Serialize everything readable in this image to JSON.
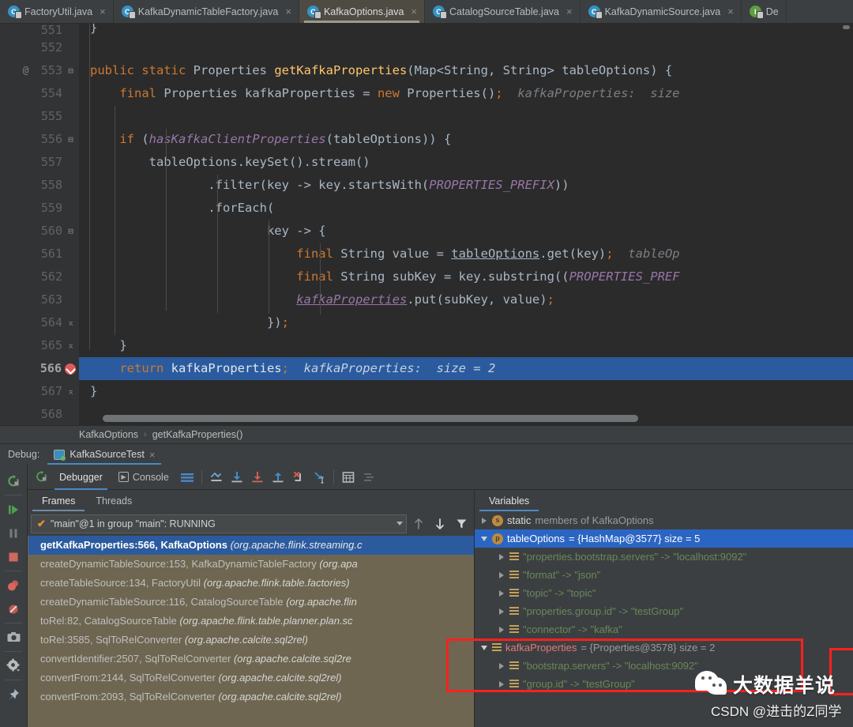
{
  "editor_tabs": [
    {
      "label": "FactoryUtil.java",
      "icon": "java-class-icon",
      "active": false
    },
    {
      "label": "KafkaDynamicTableFactory.java",
      "icon": "java-class-icon",
      "active": false
    },
    {
      "label": "KafkaOptions.java",
      "icon": "java-class-icon",
      "active": true
    },
    {
      "label": "CatalogSourceTable.java",
      "icon": "java-class-icon",
      "active": false
    },
    {
      "label": "KafkaDynamicSource.java",
      "icon": "java-class-icon",
      "active": false
    },
    {
      "label": "De",
      "icon": "java-interface-icon",
      "active": false
    }
  ],
  "tab_close_glyph": "×",
  "editor": {
    "lines": [
      {
        "num": "551",
        "annot": "",
        "fold": "",
        "partial": true
      },
      {
        "num": "552",
        "annot": "",
        "fold": ""
      },
      {
        "num": "553",
        "annot": "@",
        "fold": "minus"
      },
      {
        "num": "554",
        "annot": "",
        "fold": ""
      },
      {
        "num": "555",
        "annot": "",
        "fold": ""
      },
      {
        "num": "556",
        "annot": "",
        "fold": "minus"
      },
      {
        "num": "557",
        "annot": "",
        "fold": ""
      },
      {
        "num": "558",
        "annot": "",
        "fold": ""
      },
      {
        "num": "559",
        "annot": "",
        "fold": ""
      },
      {
        "num": "560",
        "annot": "",
        "fold": "minus"
      },
      {
        "num": "561",
        "annot": "",
        "fold": ""
      },
      {
        "num": "562",
        "annot": "",
        "fold": ""
      },
      {
        "num": "563",
        "annot": "",
        "fold": ""
      },
      {
        "num": "564",
        "annot": "",
        "fold": "up"
      },
      {
        "num": "565",
        "annot": "",
        "fold": "up"
      },
      {
        "num": "566",
        "annot": "breakpoint",
        "fold": "",
        "current": true
      },
      {
        "num": "567",
        "annot": "",
        "fold": "up"
      },
      {
        "num": "568",
        "annot": "",
        "fold": ""
      }
    ],
    "code": {
      "l551": "}",
      "l553": "public static Properties getKafkaProperties(Map<String, String> tableOptions) {",
      "l554": "final Properties kafkaProperties = new Properties();",
      "l554_hint": "kafkaProperties:  size",
      "l556": "if (hasKafkaClientProperties(tableOptions)) {",
      "l557": "tableOptions.keySet().stream()",
      "l558": ".filter(key -> key.startsWith(PROPERTIES_PREFIX))",
      "l559": ".forEach(",
      "l560": "key -> {",
      "l561": "final String value = tableOptions.get(key);",
      "l561_hint": "tableOp",
      "l562": "final String subKey = key.substring((PROPERTIES_PREF",
      "l563": "kafkaProperties.put(subKey, value);",
      "l564": "});",
      "l565": "}",
      "l566": "return kafkaProperties;",
      "l566_hint": "kafkaProperties:  size = 2",
      "l567": "}"
    }
  },
  "breadcrumb": {
    "class": "KafkaOptions",
    "separator": "›",
    "method": "getKafkaProperties()"
  },
  "debug_bar": {
    "label": "Debug:",
    "session": "KafkaSourceTest",
    "close_glyph": "×"
  },
  "left_rail": [
    {
      "name": "rerun-icon",
      "title": "Rerun"
    },
    {
      "name": "resume-program-icon",
      "title": "Resume Program"
    },
    {
      "name": "pause-program-icon",
      "title": "Pause Program"
    },
    {
      "name": "stop-icon",
      "title": "Stop"
    },
    {
      "name": "view-breakpoints-icon",
      "title": "View Breakpoints"
    },
    {
      "name": "mute-breakpoints-icon",
      "title": "Mute Breakpoints"
    },
    {
      "name": "camera-icon",
      "title": "Get thread dump"
    },
    {
      "name": "settings-gear-icon",
      "title": "Settings"
    },
    {
      "name": "pin-icon",
      "title": "Pin Tab"
    }
  ],
  "toolbar": {
    "restart_icon": "restart-icon",
    "tabs": [
      {
        "label": "Debugger",
        "active": true,
        "icon": ""
      },
      {
        "label": "Console",
        "active": false,
        "icon": "console-icon"
      }
    ],
    "layout_icon": "layout-settings-icon",
    "buttons": [
      {
        "name": "show-execution-point-icon"
      },
      {
        "name": "step-over-icon"
      },
      {
        "name": "step-into-icon"
      },
      {
        "name": "step-out-icon"
      },
      {
        "name": "force-step-into-icon"
      },
      {
        "name": "run-to-cursor-icon"
      },
      {
        "name": "evaluate-expression-icon"
      },
      {
        "name": "mute-renderers-icon"
      }
    ]
  },
  "frames_pane": {
    "tabs": [
      {
        "label": "Frames",
        "active": true
      },
      {
        "label": "Threads",
        "active": false
      }
    ],
    "thread_selector": {
      "value": "\"main\"@1 in group \"main\": RUNNING",
      "check_glyph": "✔"
    },
    "thread_buttons": [
      {
        "name": "frames-up-icon"
      },
      {
        "name": "frames-down-icon"
      },
      {
        "name": "filter-frames-icon"
      }
    ],
    "frames": [
      {
        "method": "getKafkaProperties:566, KafkaOptions ",
        "pkg": "(org.apache.flink.streaming.c",
        "selected": true
      },
      {
        "method": "createDynamicTableSource:153, KafkaDynamicTableFactory ",
        "pkg": "(org.apa",
        "selected": false
      },
      {
        "method": "createTableSource:134, FactoryUtil ",
        "pkg": "(org.apache.flink.table.factories)",
        "selected": false
      },
      {
        "method": "createDynamicTableSource:116, CatalogSourceTable ",
        "pkg": "(org.apache.flin",
        "selected": false
      },
      {
        "method": "toRel:82, CatalogSourceTable ",
        "pkg": "(org.apache.flink.table.planner.plan.sc",
        "selected": false
      },
      {
        "method": "toRel:3585, SqlToRelConverter ",
        "pkg": "(org.apache.calcite.sql2rel)",
        "selected": false
      },
      {
        "method": "convertIdentifier:2507, SqlToRelConverter ",
        "pkg": "(org.apache.calcite.sql2re",
        "selected": false
      },
      {
        "method": "convertFrom:2144, SqlToRelConverter ",
        "pkg": "(org.apache.calcite.sql2rel)",
        "selected": false
      },
      {
        "method": "convertFrom:2093, SqlToRelConverter ",
        "pkg": "(org.apache.calcite.sql2rel)",
        "selected": false
      }
    ]
  },
  "variables_pane": {
    "tabs": [
      {
        "label": "Variables",
        "active": true
      }
    ],
    "rows": [
      {
        "indent": 0,
        "arrow": "right",
        "icon": "static-icon",
        "icon_label": "s",
        "name": "static",
        "name_class": "strong",
        "suffix": " members of KafkaOptions",
        "selected": false
      },
      {
        "indent": 0,
        "arrow": "down",
        "icon": "param-icon",
        "icon_label": "p",
        "name": "tableOptions",
        "name_class": "strong",
        "suffix": " = {HashMap@3577}  size = 5",
        "selected": true
      },
      {
        "indent": 1,
        "arrow": "right",
        "icon": "map-entry-icon",
        "entry": "\"properties.bootstrap.servers\" -> \"localhost:9092\"",
        "selected": false
      },
      {
        "indent": 1,
        "arrow": "right",
        "icon": "map-entry-icon",
        "entry": "\"format\" -> \"json\"",
        "selected": false
      },
      {
        "indent": 1,
        "arrow": "right",
        "icon": "map-entry-icon",
        "entry": "\"topic\" -> \"topic\"",
        "selected": false
      },
      {
        "indent": 1,
        "arrow": "right",
        "icon": "map-entry-icon",
        "entry": "\"properties.group.id\" -> \"testGroup\"",
        "selected": false
      },
      {
        "indent": 1,
        "arrow": "right",
        "icon": "map-entry-icon",
        "entry": "\"connector\" -> \"kafka\"",
        "selected": false
      },
      {
        "indent": 0,
        "arrow": "down",
        "icon": "map-entry-icon",
        "name": "kafkaProperties",
        "name_class": "red",
        "suffix": " = {Properties@3578}  size = 2",
        "selected": false
      },
      {
        "indent": 1,
        "arrow": "right",
        "icon": "map-entry-icon",
        "entry": "\"bootstrap.servers\" -> \"localhost:9092\"",
        "selected": false
      },
      {
        "indent": 1,
        "arrow": "right",
        "icon": "map-entry-icon",
        "entry": "\"group.id\" -> \"testGroup\"",
        "selected": false
      }
    ]
  },
  "watermark": {
    "brand": "大数据羊说",
    "credit": "CSDN @进击的Z同学"
  },
  "colors": {
    "accent_blue": "#2b5b9e",
    "selection_blue": "#2b65c4",
    "frames_bg": "#6e6650",
    "keyword_orange": "#cc7832",
    "method_yellow": "#ffc66d",
    "field_purple": "#9876aa",
    "string_green": "#6a8759",
    "annotation_red": "#ff2020"
  }
}
